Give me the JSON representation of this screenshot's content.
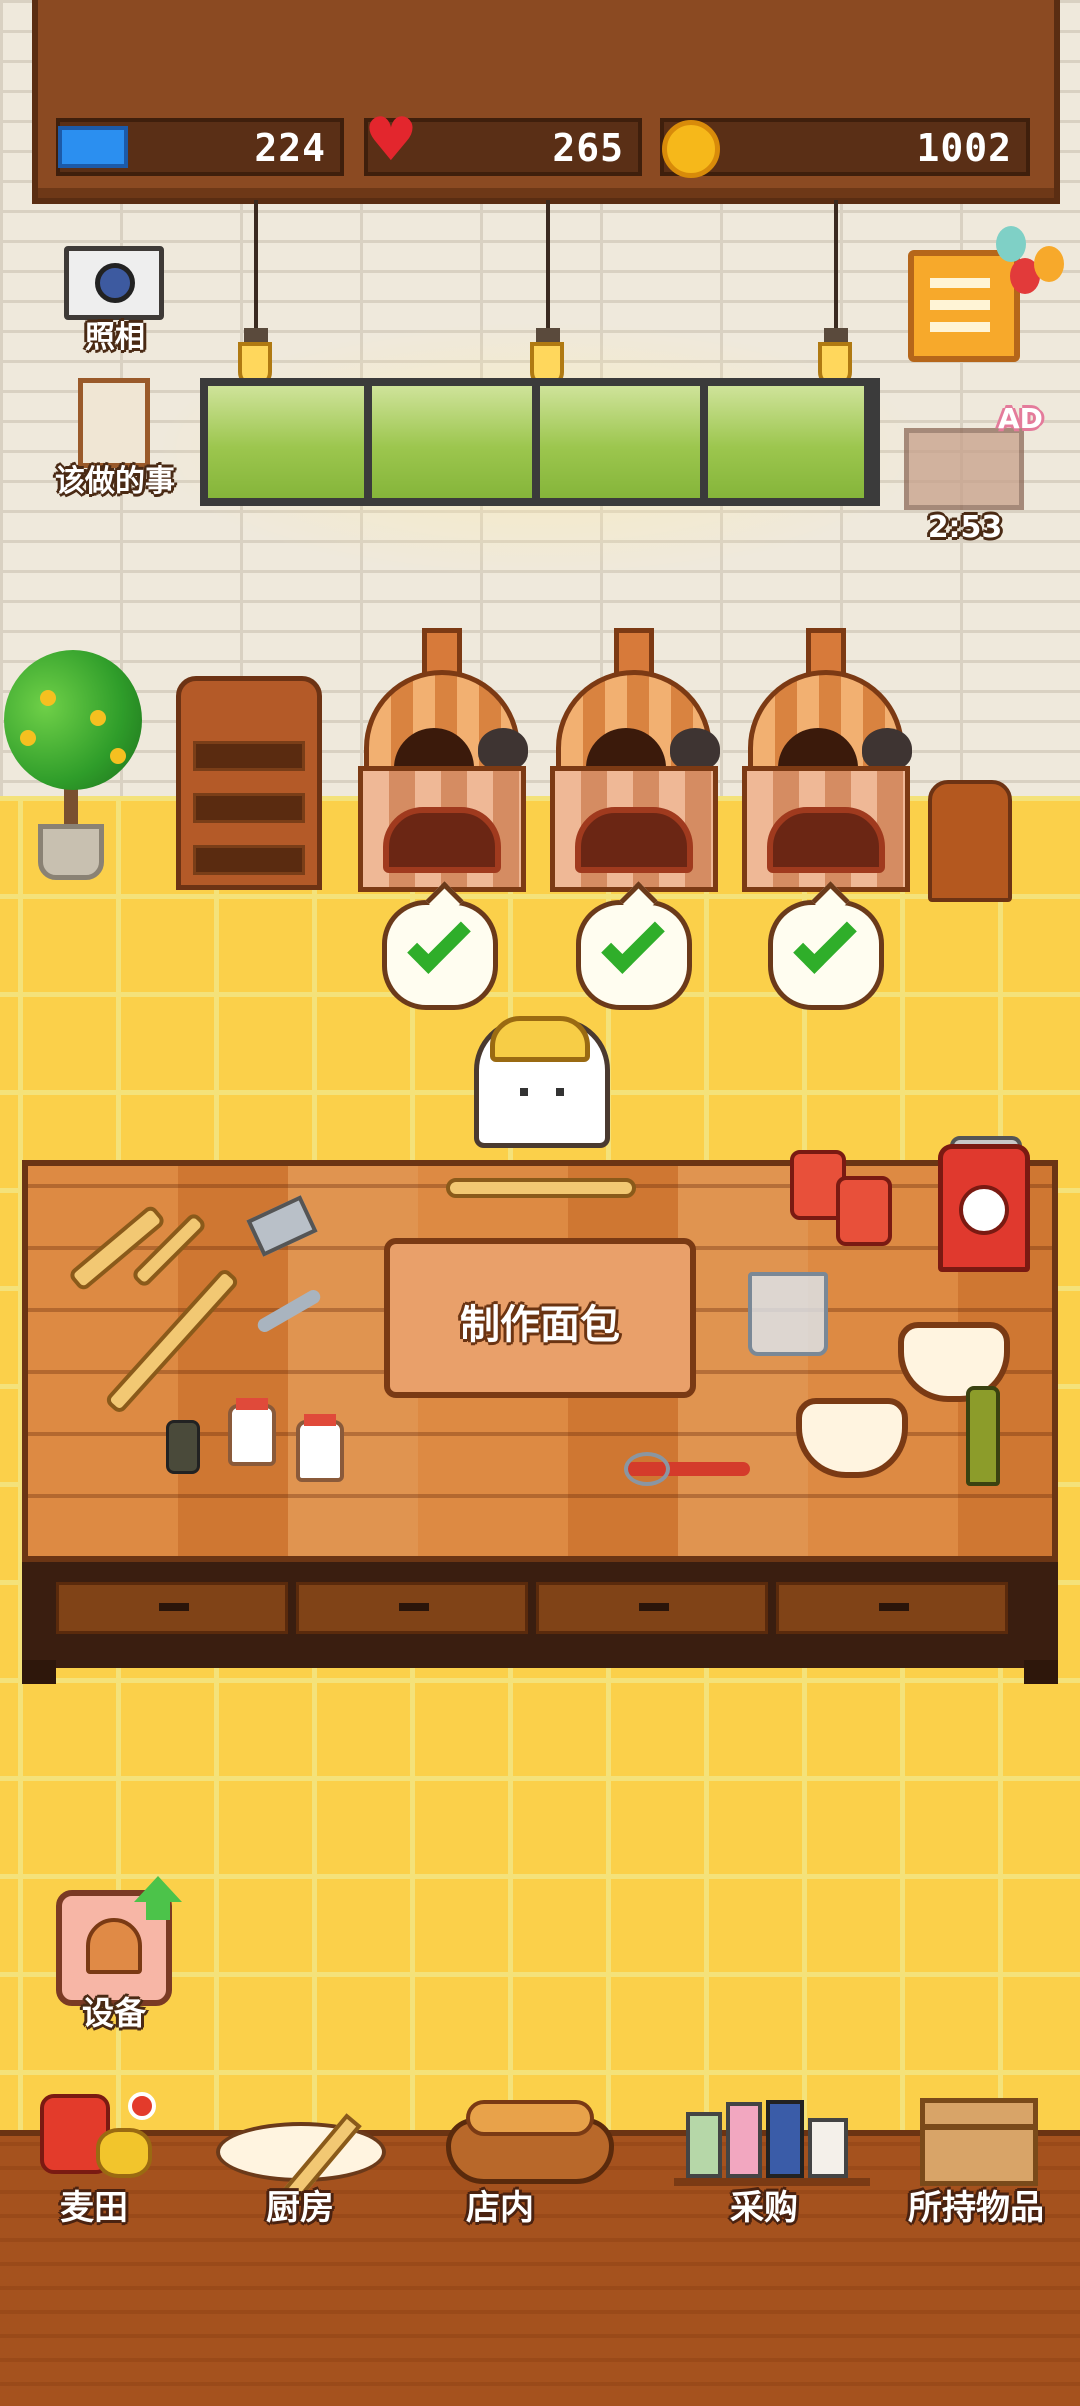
{
  "hud": {
    "tickets": "224",
    "hearts": "265",
    "coins": "1002"
  },
  "left_menu": {
    "camera_label": "照相",
    "todo_label": "该做的事"
  },
  "right_menu": {
    "ad_badge": "AD",
    "ad_timer": "2:53"
  },
  "ovens": [
    {
      "status": "ready"
    },
    {
      "status": "ready"
    },
    {
      "status": "ready"
    }
  ],
  "workbench": {
    "make_bread_label": "制作面包"
  },
  "equipment": {
    "label": "设备"
  },
  "bottom_nav": [
    {
      "id": "wheat-field",
      "label": "麦田",
      "icon": "wheat-field-icon"
    },
    {
      "id": "kitchen",
      "label": "厨房",
      "icon": "kitchen-icon"
    },
    {
      "id": "shop",
      "label": "店内",
      "icon": "bread-basket-icon"
    },
    {
      "id": "purchase",
      "label": "采购",
      "icon": "shop-shelf-icon"
    },
    {
      "id": "inventory",
      "label": "所持物品",
      "icon": "box-icon"
    }
  ],
  "colors": {
    "floor": "#fbd04a",
    "wood": "#a5521e",
    "check_green": "#2fae2a"
  }
}
